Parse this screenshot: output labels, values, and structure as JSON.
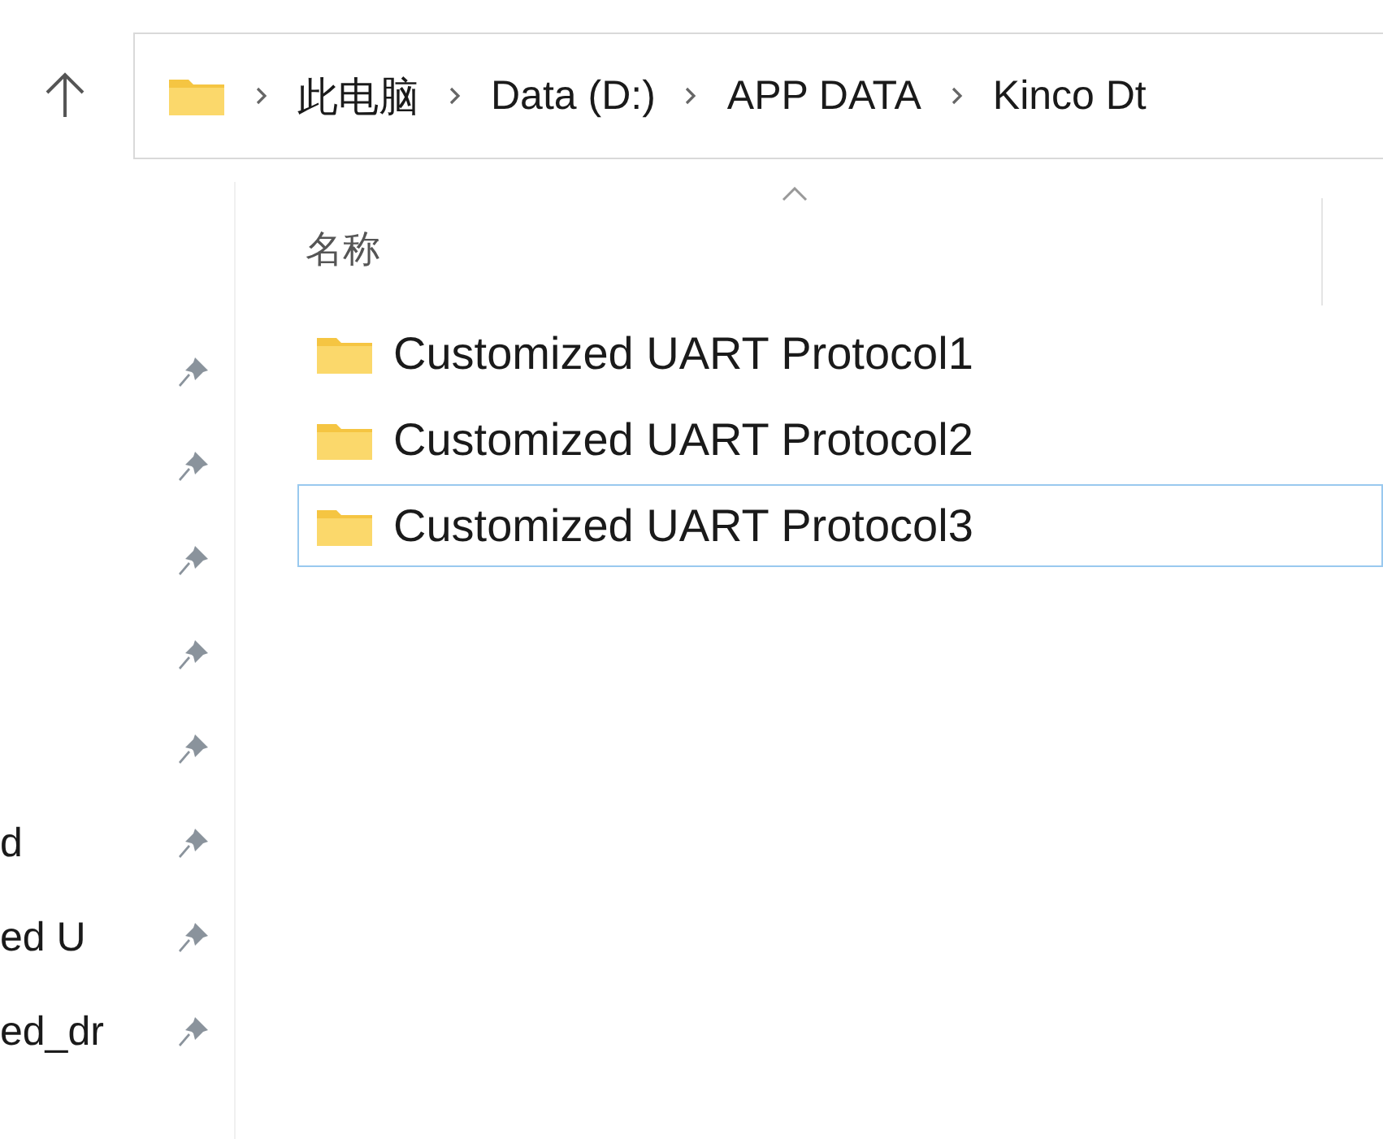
{
  "address_bar": {
    "breadcrumbs": [
      "此电脑",
      "Data (D:)",
      "APP DATA",
      "Kinco Dt"
    ]
  },
  "sidebar": {
    "items": [
      {
        "pinned": true
      },
      {
        "pinned": true
      },
      {
        "pinned": true
      },
      {
        "pinned": true
      },
      {
        "pinned": true
      },
      {
        "label": "d",
        "pinned": true
      },
      {
        "label": "ed U",
        "pinned": true
      },
      {
        "label": "ed_dr",
        "pinned": true
      }
    ]
  },
  "file_list": {
    "columns": [
      {
        "label": "名称",
        "sorted": true
      }
    ],
    "rows": [
      {
        "name": "Customized UART Protocol1",
        "selected": false
      },
      {
        "name": "Customized UART Protocol2",
        "selected": false
      },
      {
        "name": "Customized UART Protocol3",
        "selected": true
      }
    ]
  }
}
